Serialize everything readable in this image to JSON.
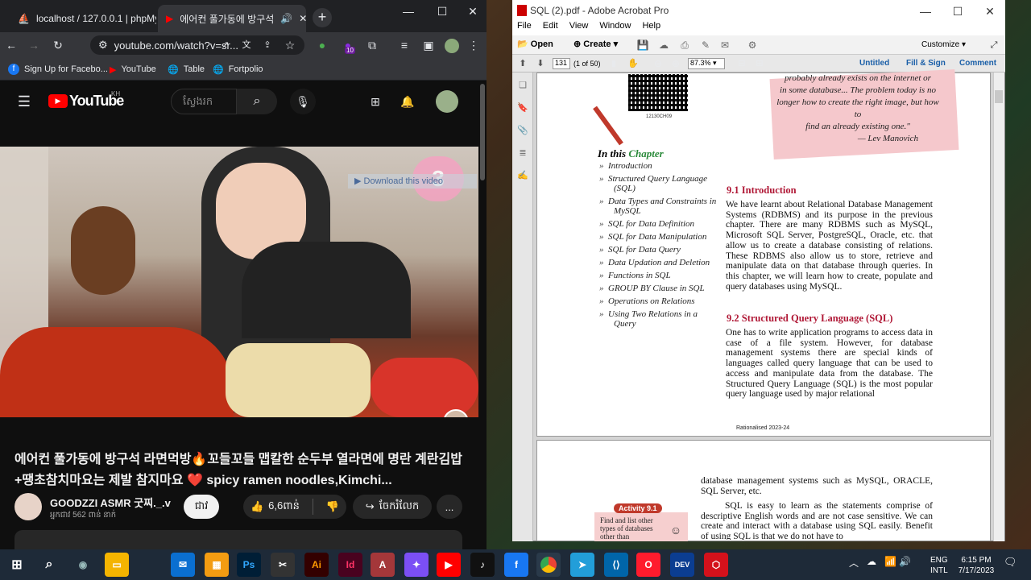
{
  "chrome": {
    "tabs": [
      {
        "label": "localhost / 127.0.0.1 | phpMy"
      },
      {
        "label": "에어컨 풀가동에 방구석"
      }
    ],
    "url": "youtube.com/watch?v=sr...",
    "ext_badge": "10",
    "bookmarks": [
      "Sign Up for Facebo...",
      "YouTube",
      "Table",
      "Fortpolio"
    ]
  },
  "youtube": {
    "logo": "YouTube",
    "region": "KH",
    "search_placeholder": "ស្វែងរក",
    "overlay": "Download this video",
    "title": "에어컨 풀가동에 방구석 라면먹방🔥꼬들꼬들 맵칼한 순두부 열라면에 명란 계란김밥+땡초참치마요는 제발 참지마요 ❤️ spicy ramen noodles,Kimchi...",
    "channel": "GOODZZI ASMR 굿찌._.v",
    "subs": "អ្នកជាវ 562 ពាន់ នាក់",
    "subscribe": "ជាវ",
    "likes": "6,6ពាន់",
    "share": "ចែករំលែក",
    "more": "..."
  },
  "acrobat": {
    "title": "SQL (2).pdf - Adobe Acrobat Pro",
    "menu": [
      "File",
      "Edit",
      "View",
      "Window",
      "Help"
    ],
    "open": "Open",
    "create": "Create",
    "customize": "Customize",
    "page_num": "131",
    "page_of": "(1 of 50)",
    "zoom": "87.3%",
    "tabs": [
      "Untitled",
      "Fill & Sign",
      "Comment"
    ],
    "quote": [
      "probably already exists on the internet or",
      "in some database... The problem today is no",
      "longer how to create the right image, but how to",
      "find an already existing one.\"",
      "— Lev Manovich"
    ],
    "qr_code": "12130CH09",
    "in_this": "In this",
    "chapter": "Chapter",
    "toc": [
      "Introduction",
      "Structured Query Language (SQL)",
      "Data Types and Constraints in MySQL",
      "SQL for Data Definition",
      "SQL for Data Manipulation",
      "SQL for Data Query",
      "Data Updation and Deletion",
      "Functions in SQL",
      "GROUP BY Clause in SQL",
      "Operations on Relations",
      "Using Two Relations in a Query"
    ],
    "h1": "9.1 Introduction",
    "p1": "We have learnt about Relational Database Management Systems (RDBMS) and its purpose in the previous chapter. There are many RDBMS such as MySQL, Microsoft SQL Server, PostgreSQL, Oracle, etc. that allow us to create a database consisting of relations. These RDBMS also allow us to store, retrieve and manipulate data on that database through queries. In this chapter, we will learn how to create, populate and query databases using MySQL.",
    "h2": "9.2 Structured Query Language (SQL)",
    "p2": "One has to write application programs to access data in case of a file system. However, for database management systems there are special kinds of languages called query language that can be used to access and manipulate data from the database. The Structured Query Language (SQL) is the most popular query language used by major relational",
    "footer": "Rationalised 2023-24",
    "p3": "database management systems such as MySQL, ORACLE, SQL Server, etc.",
    "p4": "SQL is easy to learn as the statements comprise of descriptive English words and are not case sensitive. We can create and interact with a database using SQL easily. Benefit of using SQL is that we do not have to",
    "activity": "Activity 9.1",
    "activity_text": "Find and list other types of databases other than"
  },
  "taskbar": {
    "lang": "ENG",
    "lang2": "INTL",
    "time": "6:15 PM",
    "date": "7/17/2023"
  }
}
